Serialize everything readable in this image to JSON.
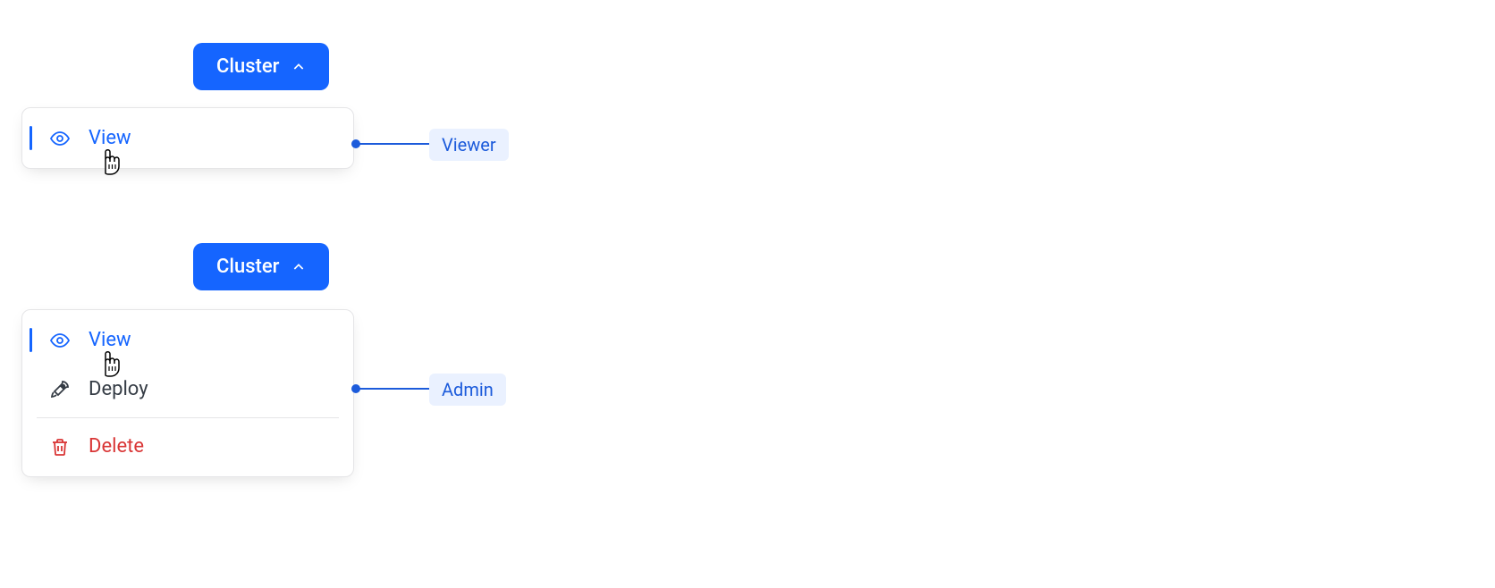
{
  "example1": {
    "button_label": "Cluster",
    "items": {
      "view": "View"
    },
    "role_label": "Viewer"
  },
  "example2": {
    "button_label": "Cluster",
    "items": {
      "view": "View",
      "deploy": "Deploy",
      "delete": "Delete"
    },
    "role_label": "Admin"
  }
}
